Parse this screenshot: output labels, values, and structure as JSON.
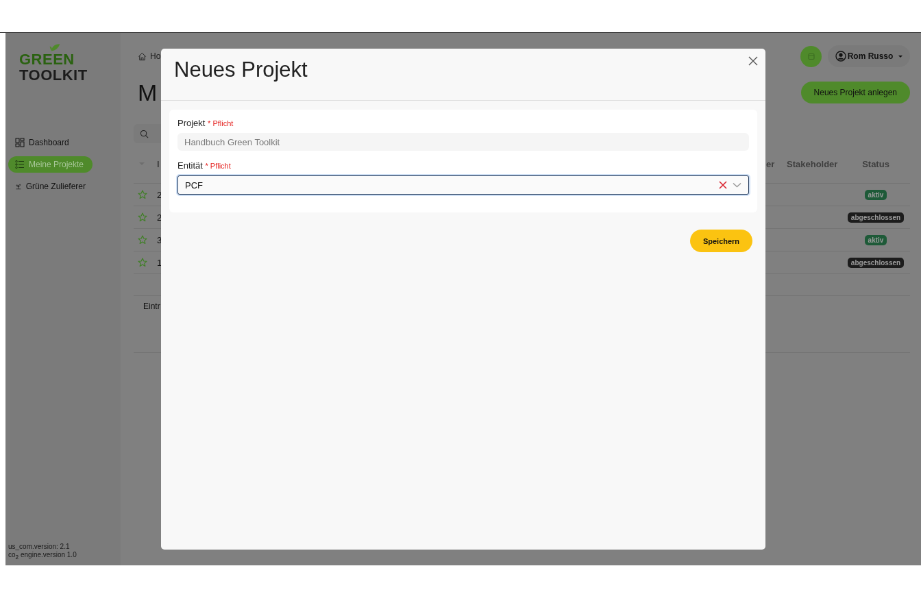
{
  "sidebar": {
    "logo": {
      "line_1": "GREEN",
      "line_2": "TOOLKIT"
    },
    "items": [
      {
        "label": "Dashboard",
        "selected": false
      },
      {
        "label": "Meine Projekte",
        "selected": true
      },
      {
        "label": "Grüne Zulieferer",
        "selected": false
      }
    ],
    "version_lines": [
      "us_com.version: 2.1",
      "co$_{2}$ engine.version 1.0"
    ]
  },
  "header": {
    "user": "Rom Russo"
  },
  "page": {
    "breadcrumb": "Ho",
    "title": "M",
    "primary_button": "Neues Projekt anlegen",
    "table": {
      "columns": [
        "I",
        "er",
        "Stakeholder",
        "Status"
      ],
      "rows": [
        {
          "starred": false,
          "id": "2",
          "status": {
            "label": "aktiv",
            "kind": "active"
          }
        },
        {
          "starred": false,
          "id": "2",
          "status": {
            "label": "abgeschlossen",
            "kind": "closed"
          }
        },
        {
          "starred": false,
          "id": "3",
          "status": {
            "label": "aktiv",
            "kind": "active"
          }
        },
        {
          "starred": false,
          "id": "1",
          "status": {
            "label": "abgeschlossen",
            "kind": "closed"
          }
        }
      ]
    },
    "footer": "Eintr"
  },
  "modal": {
    "title": "Neues Projekt",
    "fields": [
      {
        "kind": "text",
        "label": "Projekt",
        "required": "* Pflicht",
        "placeholder": "Handbuch Green Toolkit"
      },
      {
        "kind": "select",
        "label": "Entität",
        "required": "* Pflicht",
        "value": "PCF",
        "focused": true
      }
    ],
    "submit": "Speichern"
  }
}
